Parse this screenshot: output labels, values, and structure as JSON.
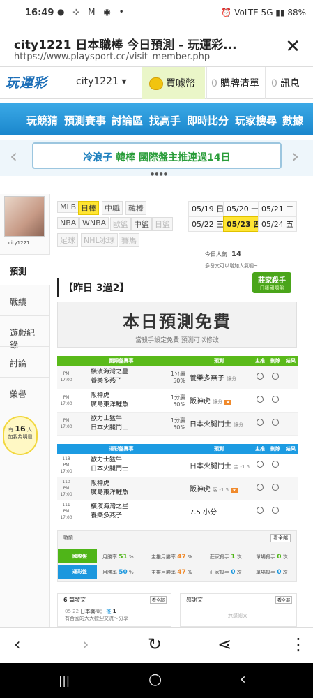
{
  "status": {
    "time": "16:49",
    "notif_icons": "● ⊹ M ◉ •",
    "right": "⏰ VoLTE 5G ▮▮ 88%"
  },
  "browser": {
    "title": "city1221 日本職棒 今日預測 - 玩運彩...",
    "url": "https://www.playsport.cc/visit_member.php"
  },
  "topnav": {
    "logo": "玩運彩",
    "user": "city1221 ▾",
    "buy": "買噱幣",
    "cart_count": "0",
    "cart": "購牌清單",
    "msg_count": "0",
    "msg": "訊息"
  },
  "menu": [
    "玩競猜",
    "預測賽事",
    "討論區",
    "找高手",
    "即時比分",
    "玩家搜尋",
    "數據"
  ],
  "notice": {
    "name": "冷浪子",
    "text": "韓棒 國際盤主推連過14日",
    "left": "‹",
    "right": "›",
    "dots": "●●●●"
  },
  "sidebar": {
    "username": "city1221",
    "items": [
      "預測",
      "戰績",
      "遊戲紀錄",
      "討論",
      "榮譽"
    ],
    "bulb_pre": "有",
    "bulb_num": "16",
    "bulb_unit": "人",
    "bulb_text": "加我為明燈"
  },
  "leagues": {
    "row1": [
      "MLB",
      "日棒",
      "中職",
      "韓棒"
    ],
    "row2": [
      "NBA",
      "WNBA",
      "歐籃",
      "中籃",
      "日籃"
    ],
    "row3": [
      "足球",
      "NHL冰球",
      "賽馬"
    ]
  },
  "dates": [
    "05/19 日",
    "05/20 一",
    "05/21 二",
    "05/22 三",
    "05/23 四",
    "05/24 五"
  ],
  "popularity": {
    "label": "今日人氣",
    "value": "14",
    "tip": "多發文可以增加人氣噢~"
  },
  "yesterday": "【昨日 3過2】",
  "badge": {
    "title": "莊家殺手",
    "sub": "日棒國際盤"
  },
  "free": {
    "title": "本日預測免費",
    "sub": "當殺手設定免費 預測可以修改"
  },
  "intl": {
    "headers": [
      "國際盤賽事",
      "預測",
      "主推",
      "刪除",
      "結果"
    ],
    "rows": [
      {
        "time1": "PM 17:00",
        "home": "橫濱海灣之星",
        "away": "養樂多燕子",
        "odds": "1分贏50%",
        "pred": "養樂多燕子",
        "note": "讓分"
      },
      {
        "time1": "PM 17:00",
        "home": "阪神虎",
        "away": "廣島東洋鯉魚",
        "odds": "1分贏50%",
        "pred": "阪神虎",
        "note": "讓分"
      },
      {
        "time1": "PM 17:00",
        "home": "歐力士猛牛",
        "away": "日本火腿鬥士",
        "odds": "1分贏50%",
        "pred": "日本火腿鬥士",
        "note": "讓分"
      }
    ]
  },
  "local": {
    "headers": [
      "運彩盤賽事",
      "預測",
      "主推",
      "刪除",
      "結果"
    ],
    "rows": [
      {
        "num": "118",
        "time1": "PM 17:00",
        "home": "歐力士猛牛",
        "away": "日本火腿鬥士",
        "pred": "日本火腿鬥士",
        "note": "主 -1.5"
      },
      {
        "num": "110",
        "time1": "PM 17:00",
        "home": "阪神虎",
        "away": "廣島東洋鯉魚",
        "pred": "阪神虎",
        "note": "客 -1.5"
      },
      {
        "num": "111",
        "time1": "PM 17:00",
        "home": "橫濱海灣之星",
        "away": "養樂多燕子",
        "pred": "7.5 小分",
        "note": ""
      }
    ]
  },
  "stats": {
    "head": "戰績",
    "all": "看全部",
    "intl": {
      "label": "國際盤",
      "win": "月勝率",
      "win_v": "51",
      "main": "主推月勝率",
      "main_v": "47",
      "killer": "莊家殺手",
      "killer_v": "1",
      "single": "單場殺手",
      "single_v": "0"
    },
    "local": {
      "label": "運彩盤",
      "win": "月勝率",
      "win_v": "50",
      "main": "主推月勝率",
      "main_v": "47",
      "killer": "莊家殺手",
      "killer_v": "0",
      "single": "單場殺手",
      "single_v": "0"
    }
  },
  "posts": {
    "count": "6",
    "label": "篇發文",
    "all": "看全部",
    "date": "05 22",
    "title": "日本職棒：",
    "snippet": "有合國的大大歡迎交流～分享",
    "tag": "推",
    "tag_n": "1"
  },
  "thanks": {
    "label": "感謝文",
    "all": "看全部",
    "none": "無感謝文"
  },
  "bottombar": {
    "back": "‹",
    "forward": "›",
    "reload": "↻",
    "share": "⋖",
    "more": "⋮"
  },
  "sysnav": {
    "recent": "|||",
    "home": "○",
    "back": "‹"
  }
}
